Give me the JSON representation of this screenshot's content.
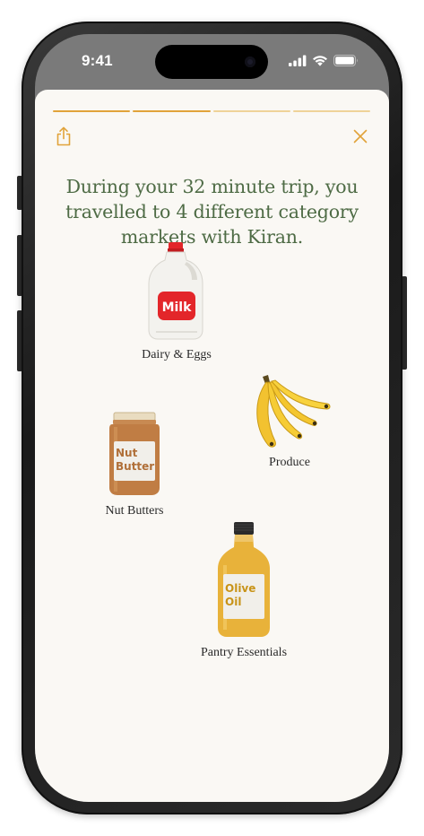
{
  "status_bar": {
    "time": "9:41",
    "icons": [
      "cellular-signal-icon",
      "wifi-icon",
      "battery-icon"
    ]
  },
  "story": {
    "progress_segments": [
      {
        "state": "complete",
        "color": "#e1a33a"
      },
      {
        "state": "complete",
        "color": "#e1a33a"
      },
      {
        "state": "upcoming",
        "color": "#efd398"
      },
      {
        "state": "upcoming",
        "color": "#efd398"
      }
    ],
    "headline": "During your 32 minute trip, you travelled to 4 different category markets with Kiran.",
    "share_icon": "share-icon",
    "close_icon": "close-icon"
  },
  "categories": [
    {
      "label": "Dairy & Eggs",
      "image": "milk-jug",
      "image_text": "Milk"
    },
    {
      "label": "Produce",
      "image": "bananas"
    },
    {
      "label": "Nut Butters",
      "image": "nut-butter-jar",
      "image_text": "Nut Butter"
    },
    {
      "label": "Pantry Essentials",
      "image": "olive-oil-bottle",
      "image_text": "Olive Oil"
    }
  ],
  "colors": {
    "accent": "#e1a33a",
    "accent_light": "#efd398",
    "headline": "#4e6b45",
    "background": "#faf8f4"
  }
}
